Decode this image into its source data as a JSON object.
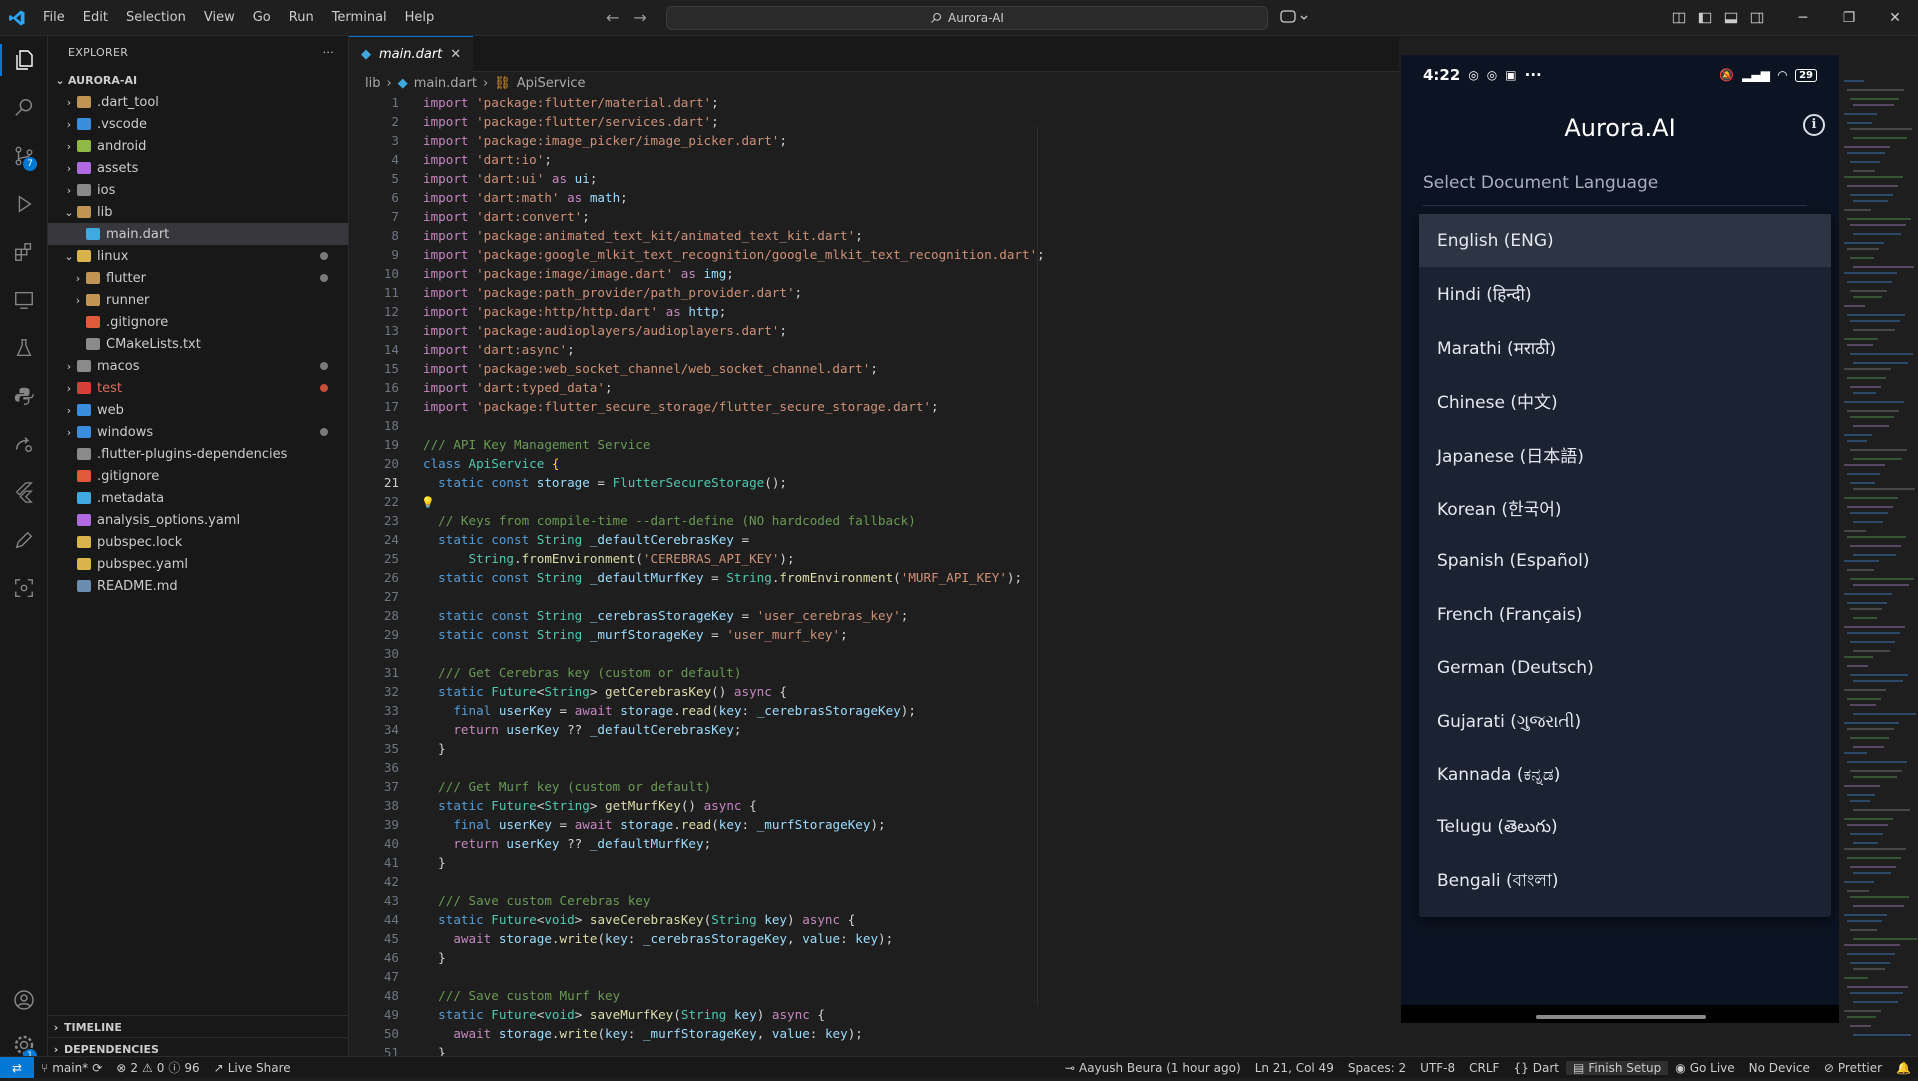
{
  "titlebar": {
    "menu": [
      "File",
      "Edit",
      "Selection",
      "View",
      "Go",
      "Run",
      "Terminal",
      "Help"
    ],
    "search_text": "Aurora-AI"
  },
  "activity_badges": {
    "source_control": "7"
  },
  "explorer": {
    "title": "EXPLORER",
    "root": "AURORA-AI",
    "items": [
      {
        "label": ".dart_tool",
        "depth": 1,
        "chev": "›",
        "color": "#c09553"
      },
      {
        "label": ".vscode",
        "depth": 1,
        "chev": "›",
        "color": "#3a8ddc"
      },
      {
        "label": "android",
        "depth": 1,
        "chev": "›",
        "color": "#8fb945"
      },
      {
        "label": "assets",
        "depth": 1,
        "chev": "›",
        "color": "#b06adf"
      },
      {
        "label": "ios",
        "depth": 1,
        "chev": "›",
        "color": "#8a8a8a"
      },
      {
        "label": "lib",
        "depth": 1,
        "chev": "⌄",
        "color": "#c09553"
      },
      {
        "label": "main.dart",
        "depth": 2,
        "chev": "",
        "color": "#40a9e0",
        "selected": true
      },
      {
        "label": "linux",
        "depth": 1,
        "chev": "⌄",
        "color": "#d9b44a",
        "dot": true
      },
      {
        "label": "flutter",
        "depth": 2,
        "chev": "›",
        "color": "#c09553",
        "dot": true
      },
      {
        "label": "runner",
        "depth": 2,
        "chev": "›",
        "color": "#c09553"
      },
      {
        "label": ".gitignore",
        "depth": 2,
        "chev": "",
        "color": "#e05a3a"
      },
      {
        "label": "CMakeLists.txt",
        "depth": 2,
        "chev": "",
        "color": "#8a8a8a"
      },
      {
        "label": "macos",
        "depth": 1,
        "chev": "›",
        "color": "#8a8a8a",
        "dot": true
      },
      {
        "label": "test",
        "depth": 1,
        "chev": "›",
        "color": "#d43f3a",
        "red": true,
        "dot_red": true
      },
      {
        "label": "web",
        "depth": 1,
        "chev": "›",
        "color": "#3a8ddc"
      },
      {
        "label": "windows",
        "depth": 1,
        "chev": "›",
        "color": "#3a8ddc",
        "dot": true
      },
      {
        "label": ".flutter-plugins-dependencies",
        "depth": 1,
        "chev": "",
        "color": "#8a8a8a"
      },
      {
        "label": ".gitignore",
        "depth": 1,
        "chev": "",
        "color": "#e05a3a"
      },
      {
        "label": ".metadata",
        "depth": 1,
        "chev": "",
        "color": "#40a9e0"
      },
      {
        "label": "analysis_options.yaml",
        "depth": 1,
        "chev": "",
        "color": "#b06adf"
      },
      {
        "label": "pubspec.lock",
        "depth": 1,
        "chev": "",
        "color": "#d9b44a"
      },
      {
        "label": "pubspec.yaml",
        "depth": 1,
        "chev": "",
        "color": "#d9b44a"
      },
      {
        "label": "README.md",
        "depth": 1,
        "chev": "",
        "color": "#6a8caf"
      }
    ],
    "timeline": "TIMELINE",
    "dependencies": "DEPENDENCIES"
  },
  "editor": {
    "tab": "main.dart",
    "breadcrumb": [
      "lib",
      "main.dart",
      "ApiService"
    ],
    "current_line": 21,
    "lines": [
      [
        [
          "k",
          "import "
        ],
        [
          "s",
          "'package:flutter/material.dart'"
        ],
        [
          "p",
          ";"
        ]
      ],
      [
        [
          "k",
          "import "
        ],
        [
          "s",
          "'package:flutter/services.dart'"
        ],
        [
          "p",
          ";"
        ]
      ],
      [
        [
          "k",
          "import "
        ],
        [
          "s",
          "'package:image_picker/image_picker.dart'"
        ],
        [
          "p",
          ";"
        ]
      ],
      [
        [
          "k",
          "import "
        ],
        [
          "s",
          "'dart:io'"
        ],
        [
          "p",
          ";"
        ]
      ],
      [
        [
          "k",
          "import "
        ],
        [
          "s",
          "'dart:ui' "
        ],
        [
          "k",
          "as "
        ],
        [
          "v",
          "ui"
        ],
        [
          "p",
          ";"
        ]
      ],
      [
        [
          "k",
          "import "
        ],
        [
          "s",
          "'dart:math' "
        ],
        [
          "k",
          "as "
        ],
        [
          "v",
          "math"
        ],
        [
          "p",
          ";"
        ]
      ],
      [
        [
          "k",
          "import "
        ],
        [
          "s",
          "'dart:convert'"
        ],
        [
          "p",
          ";"
        ]
      ],
      [
        [
          "k",
          "import "
        ],
        [
          "s",
          "'package:animated_text_kit/animated_text_kit.dart'"
        ],
        [
          "p",
          ";"
        ]
      ],
      [
        [
          "k",
          "import "
        ],
        [
          "s",
          "'package:google_mlkit_text_recognition/google_mlkit_text_recognition.dart'"
        ],
        [
          "p",
          ";"
        ]
      ],
      [
        [
          "k",
          "import "
        ],
        [
          "s",
          "'package:image/image.dart' "
        ],
        [
          "k",
          "as "
        ],
        [
          "v",
          "img"
        ],
        [
          "p",
          ";"
        ]
      ],
      [
        [
          "k",
          "import "
        ],
        [
          "s",
          "'package:path_provider/path_provider.dart'"
        ],
        [
          "p",
          ";"
        ]
      ],
      [
        [
          "k",
          "import "
        ],
        [
          "s",
          "'package:http/http.dart' "
        ],
        [
          "k",
          "as "
        ],
        [
          "v",
          "http"
        ],
        [
          "p",
          ";"
        ]
      ],
      [
        [
          "k",
          "import "
        ],
        [
          "s",
          "'package:audioplayers/audioplayers.dart'"
        ],
        [
          "p",
          ";"
        ]
      ],
      [
        [
          "k",
          "import "
        ],
        [
          "s",
          "'dart:async'"
        ],
        [
          "p",
          ";"
        ]
      ],
      [
        [
          "k",
          "import "
        ],
        [
          "s",
          "'package:web_socket_channel/web_socket_channel.dart'"
        ],
        [
          "p",
          ";"
        ]
      ],
      [
        [
          "k",
          "import "
        ],
        [
          "s",
          "'dart:typed_data'"
        ],
        [
          "p",
          ";"
        ]
      ],
      [
        [
          "k",
          "import "
        ],
        [
          "s",
          "'package:flutter_secure_storage/flutter_secure_storage.dart'"
        ],
        [
          "p",
          ";"
        ]
      ],
      [],
      [
        [
          "c",
          "/// API Key Management Service"
        ]
      ],
      [
        [
          "b",
          "class "
        ],
        [
          "t",
          "ApiService "
        ],
        [
          "y",
          "{"
        ]
      ],
      [
        [
          "p",
          "  "
        ],
        [
          "b",
          "static const "
        ],
        [
          "v",
          "storage "
        ],
        [
          "p",
          "= "
        ],
        [
          "t",
          "FlutterSecureStorage"
        ],
        [
          "p",
          "();"
        ]
      ],
      [],
      [
        [
          "p",
          "  "
        ],
        [
          "c",
          "// Keys from compile-time --dart-define (NO hardcoded fallback)"
        ]
      ],
      [
        [
          "p",
          "  "
        ],
        [
          "b",
          "static const "
        ],
        [
          "t",
          "String "
        ],
        [
          "v",
          "_defaultCerebrasKey "
        ],
        [
          "p",
          "="
        ]
      ],
      [
        [
          "p",
          "      "
        ],
        [
          "t",
          "String"
        ],
        [
          "p",
          "."
        ],
        [
          "f",
          "fromEnvironment"
        ],
        [
          "p",
          "("
        ],
        [
          "s",
          "'CEREBRAS_API_KEY'"
        ],
        [
          "p",
          ");"
        ]
      ],
      [
        [
          "p",
          "  "
        ],
        [
          "b",
          "static const "
        ],
        [
          "t",
          "String "
        ],
        [
          "v",
          "_defaultMurfKey "
        ],
        [
          "p",
          "= "
        ],
        [
          "t",
          "String"
        ],
        [
          "p",
          "."
        ],
        [
          "f",
          "fromEnvironment"
        ],
        [
          "p",
          "("
        ],
        [
          "s",
          "'MURF_API_KEY'"
        ],
        [
          "p",
          ");"
        ]
      ],
      [],
      [
        [
          "p",
          "  "
        ],
        [
          "b",
          "static const "
        ],
        [
          "t",
          "String "
        ],
        [
          "v",
          "_cerebrasStorageKey "
        ],
        [
          "p",
          "= "
        ],
        [
          "s",
          "'user_cerebras_key'"
        ],
        [
          "p",
          ";"
        ]
      ],
      [
        [
          "p",
          "  "
        ],
        [
          "b",
          "static const "
        ],
        [
          "t",
          "String "
        ],
        [
          "v",
          "_murfStorageKey "
        ],
        [
          "p",
          "= "
        ],
        [
          "s",
          "'user_murf_key'"
        ],
        [
          "p",
          ";"
        ]
      ],
      [],
      [
        [
          "p",
          "  "
        ],
        [
          "c",
          "/// Get Cerebras key (custom or default)"
        ]
      ],
      [
        [
          "p",
          "  "
        ],
        [
          "b",
          "static "
        ],
        [
          "t",
          "Future"
        ],
        [
          "p",
          "<"
        ],
        [
          "t",
          "String"
        ],
        [
          "p",
          "> "
        ],
        [
          "f",
          "getCerebrasKey"
        ],
        [
          "p",
          "() "
        ],
        [
          "k",
          "async "
        ],
        [
          "p",
          "{"
        ]
      ],
      [
        [
          "p",
          "    "
        ],
        [
          "b",
          "final "
        ],
        [
          "v",
          "userKey "
        ],
        [
          "p",
          "= "
        ],
        [
          "k",
          "await "
        ],
        [
          "v",
          "storage"
        ],
        [
          "p",
          "."
        ],
        [
          "f",
          "read"
        ],
        [
          "p",
          "("
        ],
        [
          "v",
          "key"
        ],
        [
          "p",
          ": "
        ],
        [
          "v",
          "_cerebrasStorageKey"
        ],
        [
          "p",
          ");"
        ]
      ],
      [
        [
          "p",
          "    "
        ],
        [
          "k",
          "return "
        ],
        [
          "v",
          "userKey "
        ],
        [
          "p",
          "?? "
        ],
        [
          "v",
          "_defaultCerebrasKey"
        ],
        [
          "p",
          ";"
        ]
      ],
      [
        [
          "p",
          "  }"
        ]
      ],
      [],
      [
        [
          "p",
          "  "
        ],
        [
          "c",
          "/// Get Murf key (custom or default)"
        ]
      ],
      [
        [
          "p",
          "  "
        ],
        [
          "b",
          "static "
        ],
        [
          "t",
          "Future"
        ],
        [
          "p",
          "<"
        ],
        [
          "t",
          "String"
        ],
        [
          "p",
          "> "
        ],
        [
          "f",
          "getMurfKey"
        ],
        [
          "p",
          "() "
        ],
        [
          "k",
          "async "
        ],
        [
          "p",
          "{"
        ]
      ],
      [
        [
          "p",
          "    "
        ],
        [
          "b",
          "final "
        ],
        [
          "v",
          "userKey "
        ],
        [
          "p",
          "= "
        ],
        [
          "k",
          "await "
        ],
        [
          "v",
          "storage"
        ],
        [
          "p",
          "."
        ],
        [
          "f",
          "read"
        ],
        [
          "p",
          "("
        ],
        [
          "v",
          "key"
        ],
        [
          "p",
          ": "
        ],
        [
          "v",
          "_murfStorageKey"
        ],
        [
          "p",
          ");"
        ]
      ],
      [
        [
          "p",
          "    "
        ],
        [
          "k",
          "return "
        ],
        [
          "v",
          "userKey "
        ],
        [
          "p",
          "?? "
        ],
        [
          "v",
          "_defaultMurfKey"
        ],
        [
          "p",
          ";"
        ]
      ],
      [
        [
          "p",
          "  }"
        ]
      ],
      [],
      [
        [
          "p",
          "  "
        ],
        [
          "c",
          "/// Save custom Cerebras key"
        ]
      ],
      [
        [
          "p",
          "  "
        ],
        [
          "b",
          "static "
        ],
        [
          "t",
          "Future"
        ],
        [
          "p",
          "<"
        ],
        [
          "t",
          "void"
        ],
        [
          "p",
          "> "
        ],
        [
          "f",
          "saveCerebrasKey"
        ],
        [
          "p",
          "("
        ],
        [
          "t",
          "String "
        ],
        [
          "v",
          "key"
        ],
        [
          "p",
          ") "
        ],
        [
          "k",
          "async "
        ],
        [
          "p",
          "{"
        ]
      ],
      [
        [
          "p",
          "    "
        ],
        [
          "k",
          "await "
        ],
        [
          "v",
          "storage"
        ],
        [
          "p",
          "."
        ],
        [
          "f",
          "write"
        ],
        [
          "p",
          "("
        ],
        [
          "v",
          "key"
        ],
        [
          "p",
          ": "
        ],
        [
          "v",
          "_cerebrasStorageKey"
        ],
        [
          "p",
          ", "
        ],
        [
          "v",
          "value"
        ],
        [
          "p",
          ": "
        ],
        [
          "v",
          "key"
        ],
        [
          "p",
          ");"
        ]
      ],
      [
        [
          "p",
          "  }"
        ]
      ],
      [],
      [
        [
          "p",
          "  "
        ],
        [
          "c",
          "/// Save custom Murf key"
        ]
      ],
      [
        [
          "p",
          "  "
        ],
        [
          "b",
          "static "
        ],
        [
          "t",
          "Future"
        ],
        [
          "p",
          "<"
        ],
        [
          "t",
          "void"
        ],
        [
          "p",
          "> "
        ],
        [
          "f",
          "saveMurfKey"
        ],
        [
          "p",
          "("
        ],
        [
          "t",
          "String "
        ],
        [
          "v",
          "key"
        ],
        [
          "p",
          ") "
        ],
        [
          "k",
          "async "
        ],
        [
          "p",
          "{"
        ]
      ],
      [
        [
          "p",
          "    "
        ],
        [
          "k",
          "await "
        ],
        [
          "v",
          "storage"
        ],
        [
          "p",
          "."
        ],
        [
          "f",
          "write"
        ],
        [
          "p",
          "("
        ],
        [
          "v",
          "key"
        ],
        [
          "p",
          ": "
        ],
        [
          "v",
          "_murfStorageKey"
        ],
        [
          "p",
          ", "
        ],
        [
          "v",
          "value"
        ],
        [
          "p",
          ": "
        ],
        [
          "v",
          "key"
        ],
        [
          "p",
          ");"
        ]
      ],
      [
        [
          "p",
          "  }"
        ]
      ]
    ]
  },
  "phone": {
    "time": "4:22",
    "battery": "29",
    "app_title": "Aurora.AI",
    "field_label": "Select Document Language",
    "options": [
      "English (ENG)",
      "Hindi (हिन्दी)",
      "Marathi (मराठी)",
      "Chinese (中文)",
      "Japanese (日本語)",
      "Korean (한국어)",
      "Spanish (Español)",
      "French (Français)",
      "German (Deutsch)",
      "Gujarati (ગુજરાતી)",
      "Kannada (ಕನ್ನಡ)",
      "Telugu (తెలుగు)",
      "Bengali (বাংলা)"
    ],
    "selected_index": 0
  },
  "statusbar": {
    "branch": "main*",
    "errors": "2",
    "warnings": "0",
    "infos": "96",
    "live_share": "Live Share",
    "blame": "Aayush Beura (1 hour ago)",
    "position": "Ln 21, Col 49",
    "spaces": "Spaces: 2",
    "encoding": "UTF-8",
    "eol": "CRLF",
    "language": "Dart",
    "finish_setup": "Finish Setup",
    "go_live": "Go Live",
    "device": "No Device",
    "prettier": "Prettier"
  }
}
